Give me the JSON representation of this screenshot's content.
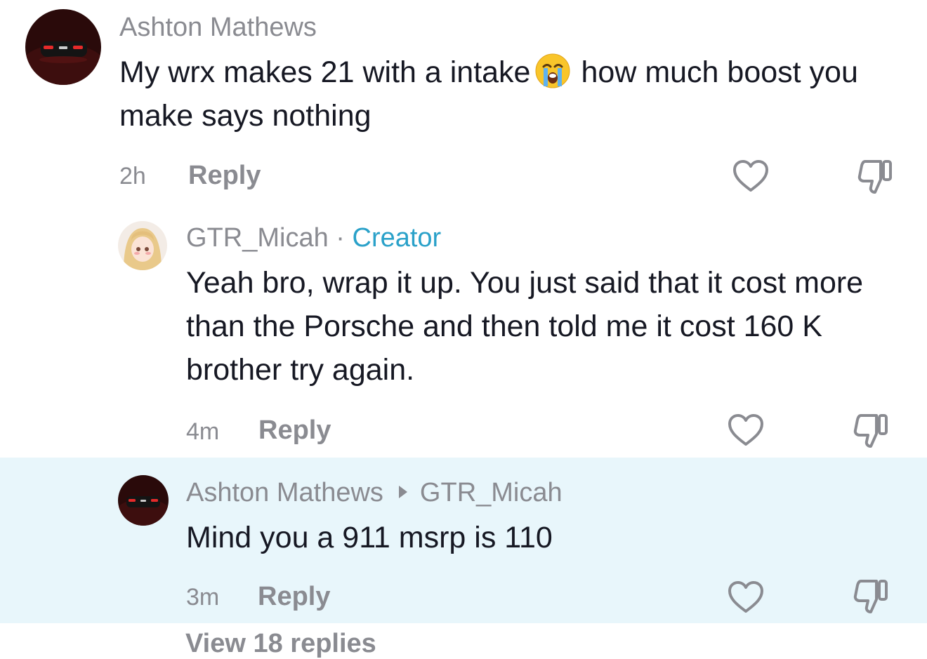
{
  "comments": [
    {
      "author": "Ashton Mathews",
      "text_before_emoji": "My wrx makes 21 with a intake",
      "emoji": "loudly-crying-face",
      "text_after_emoji": "how much boost you make says nothing",
      "time": "2h",
      "reply_label": "Reply",
      "like_icon": "heart-outline-icon",
      "dislike_icon": "thumbs-down-icon"
    },
    {
      "author": "GTR_Micah",
      "separator": "·",
      "badge": "Creator",
      "text": "Yeah bro, wrap it up. You just said that it cost more than the Porsche and then told me it cost 160 K brother try again.",
      "time": "4m",
      "reply_label": "Reply",
      "like_icon": "heart-outline-icon",
      "dislike_icon": "thumbs-down-icon"
    },
    {
      "author": "Ashton Mathews",
      "reply_to": "GTR_Micah",
      "text": "Mind you a 911 msrp is 110",
      "time": "3m",
      "reply_label": "Reply",
      "like_icon": "heart-outline-icon",
      "dislike_icon": "thumbs-down-icon",
      "highlighted": true
    }
  ],
  "view_more": "View 18 replies",
  "colors": {
    "muted": "#8a8b91",
    "creator": "#2aa1c9",
    "text": "#161823",
    "highlight": "#e8f6fb"
  }
}
